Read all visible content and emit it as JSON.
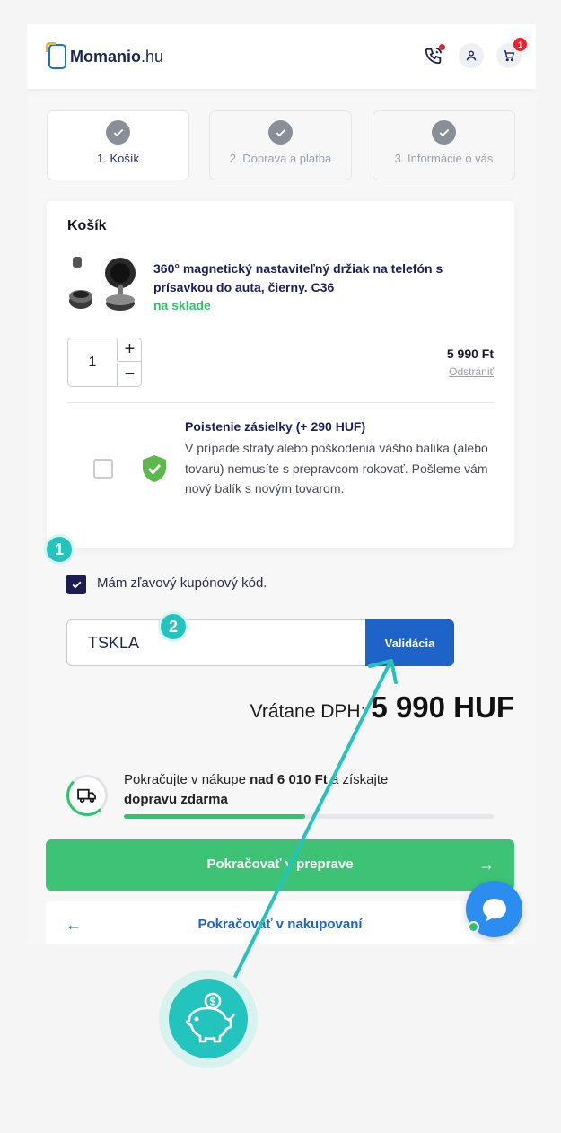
{
  "header": {
    "logo_name": "Momanio",
    "logo_tld": ".hu",
    "cart_count": "1"
  },
  "steps": [
    {
      "label": "1. Košík"
    },
    {
      "label": "2. Doprava a platba"
    },
    {
      "label": "3. Informácie o vás"
    }
  ],
  "cart": {
    "title": "Košík",
    "product_name": "360° magnetický nastaviteľný držiak na telefón s prísavkou do auta, čierny. C36",
    "stock": "na sklade",
    "quantity": "1",
    "plus": "+",
    "minus": "−",
    "price": "5 990 Ft",
    "remove": "Odstrániť",
    "insurance_title": "Poistenie zásielky (+ 290 HUF)",
    "insurance_text": "V prípade straty alebo poškodenia vášho balíka (alebo tovaru) nemusíte s prepravcom rokovať. Pošleme vám nový balík s novým tovarom."
  },
  "markers": {
    "one": "1",
    "two": "2"
  },
  "coupon": {
    "label": "Mám zľavový kupónový kód.",
    "value": "TSKLA",
    "button": "Validácia"
  },
  "total": {
    "label": "Vrátane DPH:",
    "value": "5 990 HUF"
  },
  "shipping": {
    "text_before": "Pokračujte v nákupe ",
    "text_bold": "nad 6 010 Ft",
    "text_after": " a získajte",
    "text_bold2": "dopravu zdarma",
    "progress": 0.49
  },
  "actions": {
    "continue": "Pokračovať v preprave",
    "back": "Pokračovať v nakupovaní"
  },
  "colors": {
    "accent": "#1e63c7",
    "success": "#3ec275",
    "marker": "#22c4bd",
    "checkbox": "#1d1b50"
  }
}
